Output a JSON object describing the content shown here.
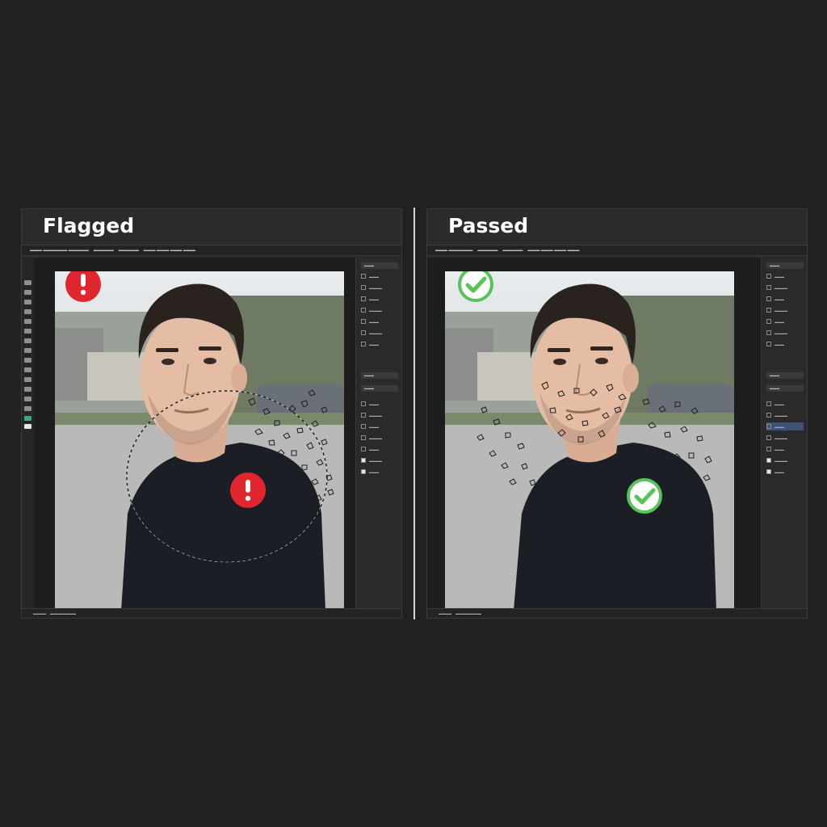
{
  "left_panel": {
    "title": "Flagged",
    "status": "flagged",
    "badge_icon": "exclamation-icon",
    "badge_color": "#e0262e",
    "selection": "dashed-ellipse-over-cheek-and-shoulder"
  },
  "right_panel": {
    "title": "Passed",
    "status": "passed",
    "badge_icon": "checkmark-icon",
    "badge_color": "#58c35a",
    "selection": "scattered-fragments-across-face-and-chest"
  },
  "photo": {
    "subject": "man in black t-shirt, street background"
  },
  "colors": {
    "background": "#212121",
    "panel": "#2b2b2b",
    "divider": "#d9d9d9",
    "flagged_red": "#e0262e",
    "passed_green": "#58c35a"
  }
}
